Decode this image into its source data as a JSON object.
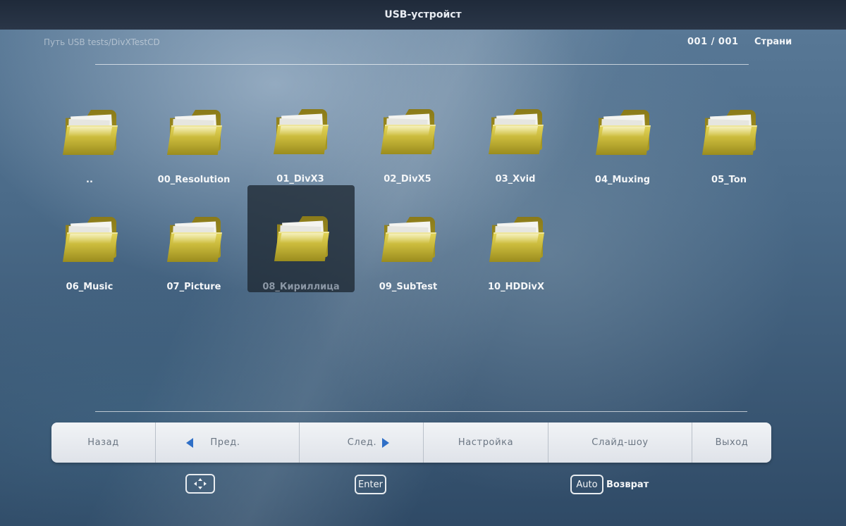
{
  "header": {
    "title": "USB-устройст"
  },
  "path": {
    "text": "Путь USB tests/DivXTestCD"
  },
  "pager": {
    "counter": "001 / 001",
    "label": "Страни"
  },
  "folders": [
    {
      "label": ".."
    },
    {
      "label": "00_Resolution"
    },
    {
      "label": "01_DivX3"
    },
    {
      "label": "02_DivX5"
    },
    {
      "label": "03_Xvid"
    },
    {
      "label": "04_Muxing"
    },
    {
      "label": "05_Ton"
    },
    {
      "label": "06_Music"
    },
    {
      "label": "07_Picture"
    },
    {
      "label": "08_Кириллица"
    },
    {
      "label": "09_SubTest"
    },
    {
      "label": "10_HDDivX"
    }
  ],
  "selected_folder": "08_Кириллица",
  "toolbar": {
    "back": "Назад",
    "prev": "Пред.",
    "next": "След.",
    "settings": "Настройка",
    "slideshow": "Слайд-шоу",
    "exit": "Выход"
  },
  "hints": {
    "enter": "Enter",
    "auto": "Auto",
    "return": "Возврат"
  },
  "icons": {
    "folder": "folder-icon",
    "navigate": "dpad-icon",
    "prev": "triangle-left-icon",
    "next": "triangle-right-icon"
  },
  "colors": {
    "accent_arrow": "#2f6fc7",
    "folder_yellow": "#d4c446",
    "title_bar": "#1f2a3a"
  }
}
